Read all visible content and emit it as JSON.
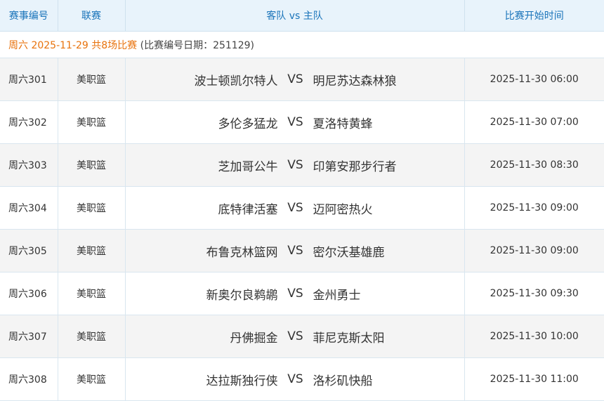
{
  "header": {
    "col_id": "赛事编号",
    "col_league": "联赛",
    "col_match": "客队 vs 主队",
    "col_time": "比赛开始时间"
  },
  "date_group": {
    "main": "周六 2025-11-29 共8场比赛",
    "extra": "(比赛编号日期：251129)"
  },
  "vs_label": "VS",
  "colors": {
    "header_bg": "#e8f3fb",
    "header_text": "#1a74ba",
    "date_accent": "#e8720c",
    "row_alt": "#f4f4f4"
  },
  "matches": [
    {
      "id": "周六301",
      "league": "美职篮",
      "away": "波士顿凯尔特人",
      "home": "明尼苏达森林狼",
      "time": "2025-11-30 06:00"
    },
    {
      "id": "周六302",
      "league": "美职篮",
      "away": "多伦多猛龙",
      "home": "夏洛特黄蜂",
      "time": "2025-11-30 07:00"
    },
    {
      "id": "周六303",
      "league": "美职篮",
      "away": "芝加哥公牛",
      "home": "印第安那步行者",
      "time": "2025-11-30 08:30"
    },
    {
      "id": "周六304",
      "league": "美职篮",
      "away": "底特律活塞",
      "home": "迈阿密热火",
      "time": "2025-11-30 09:00"
    },
    {
      "id": "周六305",
      "league": "美职篮",
      "away": "布鲁克林篮网",
      "home": "密尔沃基雄鹿",
      "time": "2025-11-30 09:00"
    },
    {
      "id": "周六306",
      "league": "美职篮",
      "away": "新奥尔良鹈鹕",
      "home": "金州勇士",
      "time": "2025-11-30 09:30"
    },
    {
      "id": "周六307",
      "league": "美职篮",
      "away": "丹佛掘金",
      "home": "菲尼克斯太阳",
      "time": "2025-11-30 10:00"
    },
    {
      "id": "周六308",
      "league": "美职篮",
      "away": "达拉斯独行侠",
      "home": "洛杉矶快船",
      "time": "2025-11-30 11:00"
    }
  ]
}
